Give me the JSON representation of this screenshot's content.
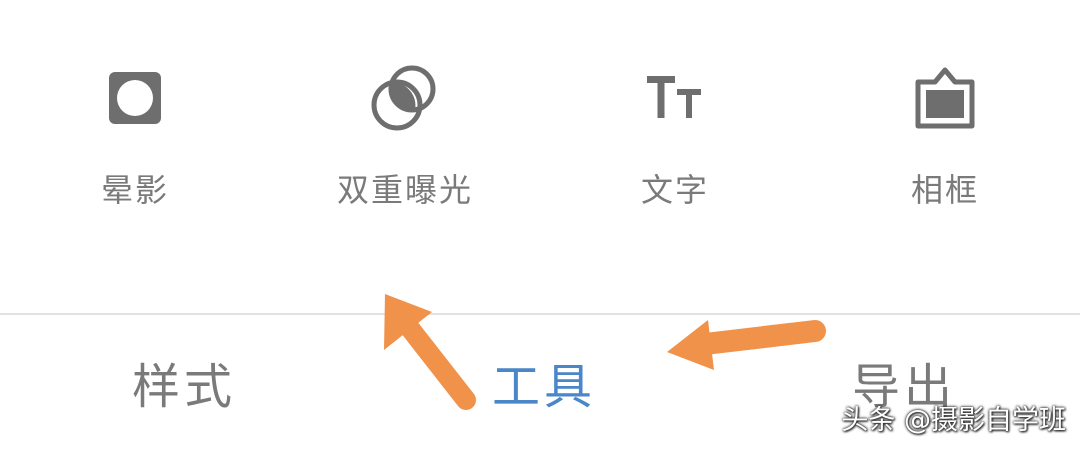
{
  "tools": {
    "items": [
      {
        "label": "晕影",
        "icon": "vignette-icon"
      },
      {
        "label": "双重曝光",
        "icon": "double-exposure-icon"
      },
      {
        "label": "文字",
        "icon": "text-icon"
      },
      {
        "label": "相框",
        "icon": "frame-icon"
      }
    ]
  },
  "tabs": {
    "items": [
      {
        "label": "样式",
        "active": false
      },
      {
        "label": "工具",
        "active": true
      },
      {
        "label": "导出",
        "active": false
      }
    ]
  },
  "watermark": "头条 @摄影自学班",
  "colors": {
    "icon": "#6e6e6e",
    "label": "#7a7a7a",
    "active_tab": "#4a86c8",
    "arrow": "#f0924a",
    "divider": "#e2e2e2"
  }
}
